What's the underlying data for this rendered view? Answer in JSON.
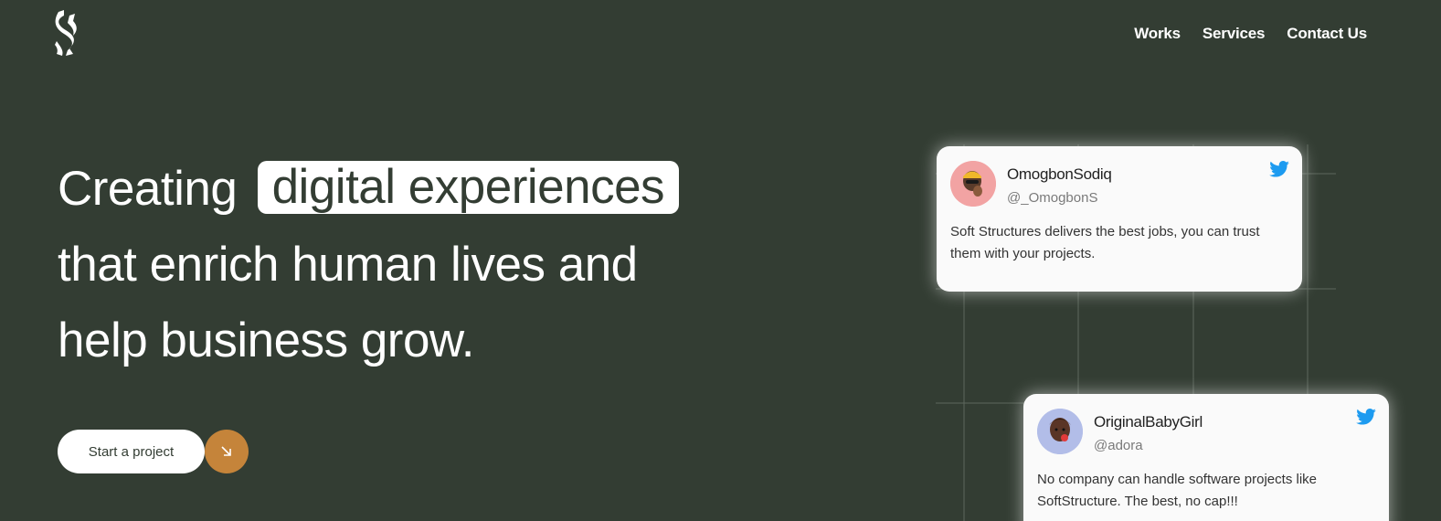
{
  "brand": {
    "logo_icon": "s-logo-icon",
    "bg_color": "#333d33",
    "accent_color": "#c5843a"
  },
  "nav": {
    "items": [
      {
        "label": "Works"
      },
      {
        "label": "Services"
      },
      {
        "label": "Contact Us"
      }
    ]
  },
  "hero": {
    "line1_prefix": "Creating",
    "line1_highlight": "digital experiences",
    "line2": "that enrich human lives and",
    "line3": "help business grow."
  },
  "cta": {
    "label": "Start a project",
    "arrow_icon": "arrow-down-right-icon"
  },
  "testimonials": [
    {
      "name": "OmogbonSodiq",
      "handle": "@_OmogbonS",
      "text": "Soft Structures delivers the best jobs, you can trust them with your projects.",
      "avatar_color": "#f2a3a3",
      "icon": "twitter-icon"
    },
    {
      "name": "OriginalBabyGirl",
      "handle": "@adora",
      "text": "No company can handle software projects like SoftStructure. The best, no cap!!!",
      "avatar_color": "#b2bde8",
      "icon": "twitter-icon"
    }
  ]
}
